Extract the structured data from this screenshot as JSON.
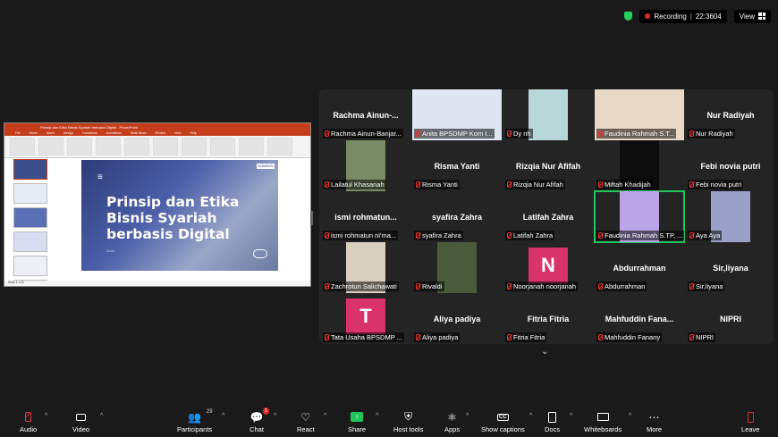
{
  "topbar": {
    "recording": "Recording",
    "timer": "22:3604",
    "view": "View"
  },
  "share": {
    "window_title": "Prinsip dan Etika Bisnis Syariah berbasis Digital - PowerPoint",
    "menu": [
      "File",
      "Home",
      "Insert",
      "Design",
      "Transitions",
      "Animations",
      "Slide Show",
      "Review",
      "View",
      "Help"
    ],
    "slide_title": "Prinsip dan Etika Bisnis Syariah berbasis Digital",
    "slide_logo": "KOMDIGI",
    "slide_date": "2024",
    "status_text": "Slide 1 of 8"
  },
  "gallery": {
    "tiles": [
      {
        "name": "Rachma Ainun-Banjar...",
        "big": "Rachma Ainun-...",
        "kind": "name"
      },
      {
        "name": "Anita BPSDMP Kom I...",
        "kind": "video",
        "style": "wide",
        "bg": "#dfe6f2"
      },
      {
        "name": "Dy nh",
        "kind": "video",
        "style": "narrow",
        "bg": "#b9d7d9"
      },
      {
        "name": "Faudinia Rahmah S.T...",
        "kind": "video",
        "style": "wide",
        "bg": "#e7d9c5"
      },
      {
        "name": "Nur Radiyah",
        "big": "Nur Radiyah",
        "kind": "name"
      },
      {
        "name": "Lailatul Khasanah",
        "kind": "video",
        "style": "narrow",
        "bg": "#7a8a66"
      },
      {
        "name": "Risma Yanti",
        "big": "Risma Yanti",
        "kind": "name"
      },
      {
        "name": "Rizqia Nur Afifah",
        "big": "Rizqia Nur Afifah",
        "kind": "name"
      },
      {
        "name": "Miftah Khadijah",
        "kind": "video",
        "style": "narrow",
        "bg": "#0c0c0c"
      },
      {
        "name": "Febi novia putri",
        "big": "Febi novia putri",
        "kind": "name"
      },
      {
        "name": "ismi rohmatun ni'ma...",
        "big": "ismi rohmatun...",
        "kind": "name"
      },
      {
        "name": "syafira Zahra",
        "big": "syafira Zahra",
        "kind": "name"
      },
      {
        "name": "Latifah Zahra",
        "big": "Latifah Zahra",
        "kind": "name"
      },
      {
        "name": "Faudinia Rahmah S.TP, ...",
        "kind": "video",
        "style": "narrow",
        "bg": "#b9a4e6",
        "active": true
      },
      {
        "name": "Aya Aya",
        "kind": "video",
        "style": "narrow",
        "bg": "#9aa0c8"
      },
      {
        "name": "Zachrotun Salichawati",
        "kind": "video",
        "style": "narrow",
        "bg": "#d8cfc0"
      },
      {
        "name": "Rivaldi",
        "kind": "video",
        "style": "narrow",
        "bg": "#4a5a3a"
      },
      {
        "name": "Noorjanah noorjanah",
        "kind": "avatar",
        "letter": "N",
        "bg": "#d8336a"
      },
      {
        "name": "Abdurrahman",
        "big": "Abdurrahman",
        "kind": "name"
      },
      {
        "name": "Sir,liyana",
        "big": "Sir,liyana",
        "kind": "name"
      },
      {
        "name": "Tata Usaha BPSDMP ...",
        "kind": "avatar",
        "letter": "T",
        "bg": "#d8336a"
      },
      {
        "name": "Aliya padiya",
        "big": "Aliya padiya",
        "kind": "name"
      },
      {
        "name": "Fitria Fitria",
        "big": "Fitria Fitria",
        "kind": "name"
      },
      {
        "name": "Mahfuddin Fanany",
        "big": "Mahfuddin Fana...",
        "kind": "name"
      },
      {
        "name": "NIPRI",
        "big": "NIPRI",
        "kind": "name"
      }
    ]
  },
  "toolbar": {
    "audio": "Audio",
    "video": "Video",
    "participants": "Participants",
    "participants_count": "29",
    "chat": "Chat",
    "chat_badge": "1",
    "react": "React",
    "share": "Share",
    "host_tools": "Host tools",
    "apps": "Apps",
    "captions": "Show captions",
    "docs": "Docs",
    "whiteboards": "Whiteboards",
    "more": "More",
    "leave": "Leave"
  },
  "colors": {
    "active_speaker": "#23c45e",
    "mute": "#e33333",
    "share_green": "#23c45e",
    "powerpoint": "#c43e1c"
  }
}
